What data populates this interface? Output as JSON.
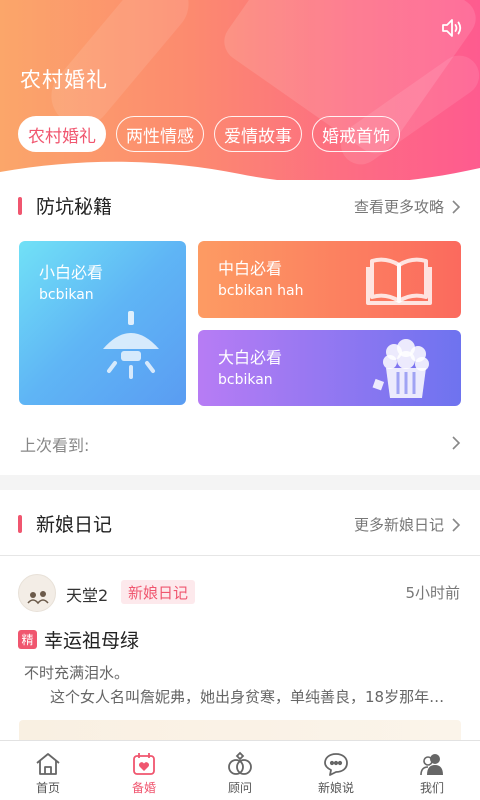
{
  "header": {
    "title": "农村婚礼",
    "speaker_icon": "speaker-icon",
    "pills": [
      {
        "label": "农村婚礼",
        "active": true
      },
      {
        "label": "两性情感",
        "active": false
      },
      {
        "label": "爱情故事",
        "active": false
      },
      {
        "label": "婚戒首饰",
        "active": false
      }
    ]
  },
  "guide": {
    "title": "防坑秘籍",
    "more": "查看更多攻略",
    "tiles": [
      {
        "title": "小白必看",
        "subtitle": "bcbikan",
        "icon": "lamp-icon"
      },
      {
        "title": "中白必看",
        "subtitle": "bcbikan hah",
        "icon": "book-icon"
      },
      {
        "title": "大白必看",
        "subtitle": "bcbikan",
        "icon": "popcorn-icon"
      }
    ],
    "last_seen": "上次看到:"
  },
  "diary": {
    "title": "新娘日记",
    "more": "更多新娘日记",
    "post": {
      "username": "天堂2",
      "tag": "新娘日记",
      "time": "5小时前",
      "badge": "精",
      "title": "幸运祖母绿",
      "excerpt1": "不时充满泪水。",
      "excerpt2": "这个女人名叫詹妮弗，她出身贫寒，单纯善良，18岁那年…"
    }
  },
  "tabbar": [
    {
      "label": "首页",
      "icon": "home-icon",
      "active": false
    },
    {
      "label": "备婚",
      "icon": "calendar-heart-icon",
      "active": true
    },
    {
      "label": "顾问",
      "icon": "rings-icon",
      "active": false
    },
    {
      "label": "新娘说",
      "icon": "chat-bubble-icon",
      "active": false
    },
    {
      "label": "我们",
      "icon": "couple-icon",
      "active": false
    }
  ],
  "colors": {
    "accent": "#f0566f"
  }
}
